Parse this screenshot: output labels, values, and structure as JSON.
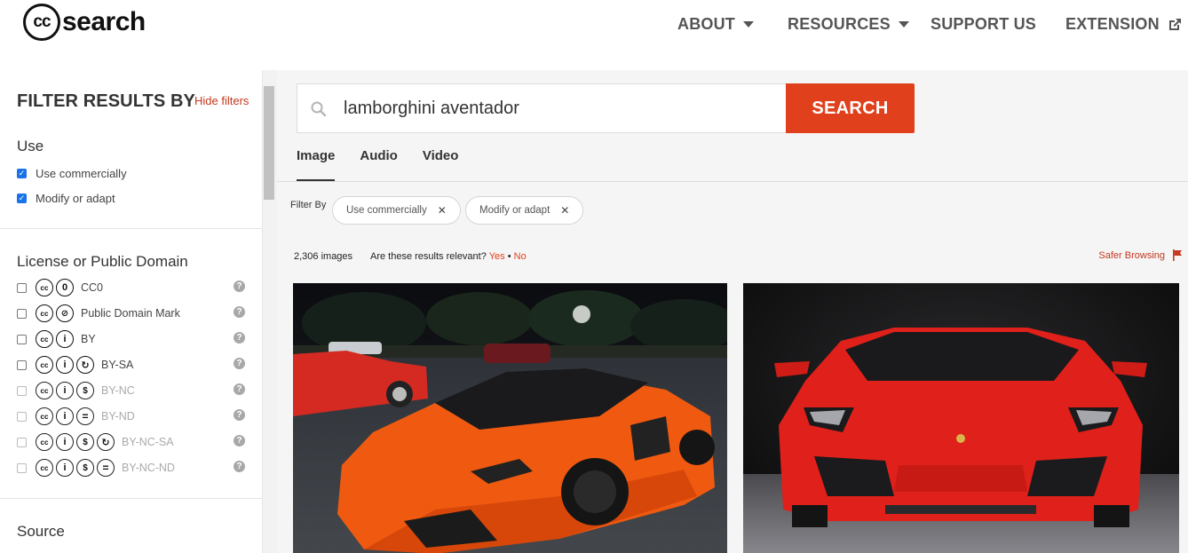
{
  "header": {
    "logo_cc": "cc",
    "logo_text": "search",
    "nav": [
      {
        "label": "ABOUT",
        "has_caret": true
      },
      {
        "label": "RESOURCES",
        "has_caret": true
      },
      {
        "label": "SUPPORT US",
        "has_caret": false
      },
      {
        "label": "EXTENSION",
        "icon": "external-link-icon"
      }
    ]
  },
  "sidebar": {
    "title": "FILTER RESULTS BY",
    "hide_filters": "Hide filters",
    "use": {
      "title": "Use",
      "options": [
        {
          "label": "Use commercially",
          "checked": true
        },
        {
          "label": "Modify or adapt",
          "checked": true
        }
      ]
    },
    "license": {
      "title": "License or Public Domain",
      "options": [
        {
          "label": "CC0",
          "icons": [
            "cc",
            "zero"
          ],
          "enabled": true
        },
        {
          "label": "Public Domain Mark",
          "icons": [
            "cc",
            "pd"
          ],
          "enabled": true
        },
        {
          "label": "BY",
          "icons": [
            "cc",
            "by"
          ],
          "enabled": true
        },
        {
          "label": "BY-SA",
          "icons": [
            "cc",
            "by",
            "sa"
          ],
          "enabled": true
        },
        {
          "label": "BY-NC",
          "icons": [
            "cc",
            "by",
            "nc"
          ],
          "enabled": false
        },
        {
          "label": "BY-ND",
          "icons": [
            "cc",
            "by",
            "nd"
          ],
          "enabled": false
        },
        {
          "label": "BY-NC-SA",
          "icons": [
            "cc",
            "by",
            "nc",
            "sa"
          ],
          "enabled": false
        },
        {
          "label": "BY-NC-ND",
          "icons": [
            "cc",
            "by",
            "nc",
            "nd"
          ],
          "enabled": false
        }
      ]
    },
    "source_title": "Source"
  },
  "search": {
    "query": "lamborghini aventador",
    "button": "SEARCH"
  },
  "tabs": [
    {
      "label": "Image",
      "active": true
    },
    {
      "label": "Audio",
      "active": false
    },
    {
      "label": "Video",
      "active": false
    }
  ],
  "filters": {
    "label": "Filter By",
    "chips": [
      "Use commercially",
      "Modify or adapt"
    ]
  },
  "results": {
    "count": "2,306 images",
    "relevance_question": "Are these results relevant?",
    "yes": "Yes",
    "separator": "•",
    "no": "No",
    "safer_browsing": "Safer Browsing"
  },
  "colors": {
    "accent": "#e0401b",
    "orange_car": "#f05a10",
    "red_car": "#e0201a"
  }
}
